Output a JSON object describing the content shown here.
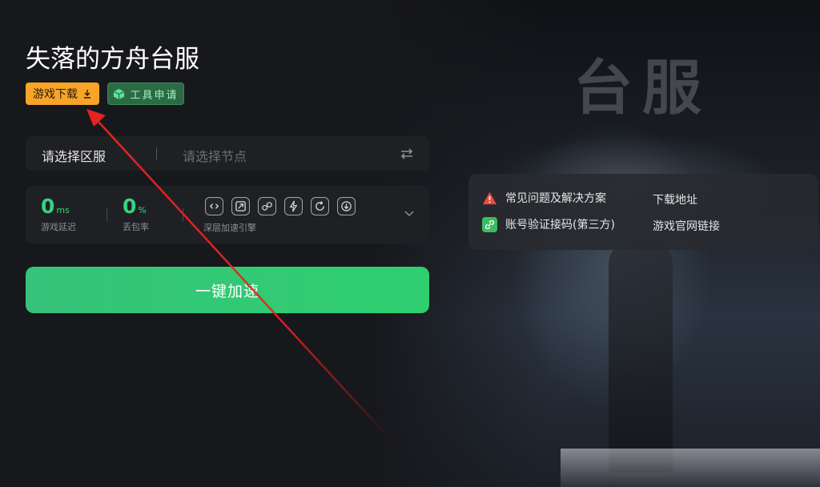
{
  "header": {
    "title": "失落的方舟台服",
    "download_button": "游戏下载",
    "tool_button": "工具申请"
  },
  "background": {
    "title_art": "台服"
  },
  "selector": {
    "region_label": "请选择区服",
    "node_placeholder": "请选择节点"
  },
  "stats": {
    "latency_value": "0",
    "latency_unit": "ms",
    "latency_caption": "游戏延迟",
    "loss_value": "0",
    "loss_unit": "%",
    "loss_caption": "丢包率",
    "engine_caption": "深层加速引擎"
  },
  "boost_button": "一键加速",
  "help": {
    "faq": "常见问题及解决方案",
    "download_address": "下载地址",
    "account_code": "账号验证接码(第三方)",
    "official_link": "游戏官网链接"
  },
  "colors": {
    "accent_green": "#34d47e",
    "download_orange": "#f7a428",
    "tool_green": "#2c6a46",
    "annotation_red": "#e8221f"
  }
}
